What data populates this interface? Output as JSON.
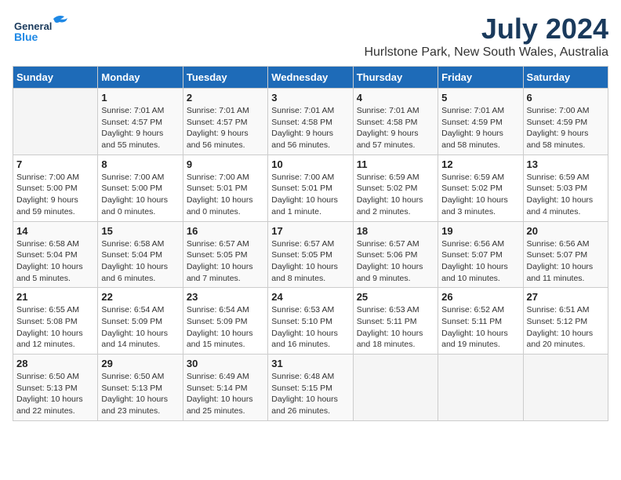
{
  "logo": {
    "text1": "General",
    "text2": "Blue"
  },
  "title": "July 2024",
  "subtitle": "Hurlstone Park, New South Wales, Australia",
  "days_of_week": [
    "Sunday",
    "Monday",
    "Tuesday",
    "Wednesday",
    "Thursday",
    "Friday",
    "Saturday"
  ],
  "weeks": [
    [
      {
        "day": "",
        "info": ""
      },
      {
        "day": "1",
        "info": "Sunrise: 7:01 AM\nSunset: 4:57 PM\nDaylight: 9 hours\nand 55 minutes."
      },
      {
        "day": "2",
        "info": "Sunrise: 7:01 AM\nSunset: 4:57 PM\nDaylight: 9 hours\nand 56 minutes."
      },
      {
        "day": "3",
        "info": "Sunrise: 7:01 AM\nSunset: 4:58 PM\nDaylight: 9 hours\nand 56 minutes."
      },
      {
        "day": "4",
        "info": "Sunrise: 7:01 AM\nSunset: 4:58 PM\nDaylight: 9 hours\nand 57 minutes."
      },
      {
        "day": "5",
        "info": "Sunrise: 7:01 AM\nSunset: 4:59 PM\nDaylight: 9 hours\nand 58 minutes."
      },
      {
        "day": "6",
        "info": "Sunrise: 7:00 AM\nSunset: 4:59 PM\nDaylight: 9 hours\nand 58 minutes."
      }
    ],
    [
      {
        "day": "7",
        "info": "Sunrise: 7:00 AM\nSunset: 5:00 PM\nDaylight: 9 hours\nand 59 minutes."
      },
      {
        "day": "8",
        "info": "Sunrise: 7:00 AM\nSunset: 5:00 PM\nDaylight: 10 hours\nand 0 minutes."
      },
      {
        "day": "9",
        "info": "Sunrise: 7:00 AM\nSunset: 5:01 PM\nDaylight: 10 hours\nand 0 minutes."
      },
      {
        "day": "10",
        "info": "Sunrise: 7:00 AM\nSunset: 5:01 PM\nDaylight: 10 hours\nand 1 minute."
      },
      {
        "day": "11",
        "info": "Sunrise: 6:59 AM\nSunset: 5:02 PM\nDaylight: 10 hours\nand 2 minutes."
      },
      {
        "day": "12",
        "info": "Sunrise: 6:59 AM\nSunset: 5:02 PM\nDaylight: 10 hours\nand 3 minutes."
      },
      {
        "day": "13",
        "info": "Sunrise: 6:59 AM\nSunset: 5:03 PM\nDaylight: 10 hours\nand 4 minutes."
      }
    ],
    [
      {
        "day": "14",
        "info": "Sunrise: 6:58 AM\nSunset: 5:04 PM\nDaylight: 10 hours\nand 5 minutes."
      },
      {
        "day": "15",
        "info": "Sunrise: 6:58 AM\nSunset: 5:04 PM\nDaylight: 10 hours\nand 6 minutes."
      },
      {
        "day": "16",
        "info": "Sunrise: 6:57 AM\nSunset: 5:05 PM\nDaylight: 10 hours\nand 7 minutes."
      },
      {
        "day": "17",
        "info": "Sunrise: 6:57 AM\nSunset: 5:05 PM\nDaylight: 10 hours\nand 8 minutes."
      },
      {
        "day": "18",
        "info": "Sunrise: 6:57 AM\nSunset: 5:06 PM\nDaylight: 10 hours\nand 9 minutes."
      },
      {
        "day": "19",
        "info": "Sunrise: 6:56 AM\nSunset: 5:07 PM\nDaylight: 10 hours\nand 10 minutes."
      },
      {
        "day": "20",
        "info": "Sunrise: 6:56 AM\nSunset: 5:07 PM\nDaylight: 10 hours\nand 11 minutes."
      }
    ],
    [
      {
        "day": "21",
        "info": "Sunrise: 6:55 AM\nSunset: 5:08 PM\nDaylight: 10 hours\nand 12 minutes."
      },
      {
        "day": "22",
        "info": "Sunrise: 6:54 AM\nSunset: 5:09 PM\nDaylight: 10 hours\nand 14 minutes."
      },
      {
        "day": "23",
        "info": "Sunrise: 6:54 AM\nSunset: 5:09 PM\nDaylight: 10 hours\nand 15 minutes."
      },
      {
        "day": "24",
        "info": "Sunrise: 6:53 AM\nSunset: 5:10 PM\nDaylight: 10 hours\nand 16 minutes."
      },
      {
        "day": "25",
        "info": "Sunrise: 6:53 AM\nSunset: 5:11 PM\nDaylight: 10 hours\nand 18 minutes."
      },
      {
        "day": "26",
        "info": "Sunrise: 6:52 AM\nSunset: 5:11 PM\nDaylight: 10 hours\nand 19 minutes."
      },
      {
        "day": "27",
        "info": "Sunrise: 6:51 AM\nSunset: 5:12 PM\nDaylight: 10 hours\nand 20 minutes."
      }
    ],
    [
      {
        "day": "28",
        "info": "Sunrise: 6:50 AM\nSunset: 5:13 PM\nDaylight: 10 hours\nand 22 minutes."
      },
      {
        "day": "29",
        "info": "Sunrise: 6:50 AM\nSunset: 5:13 PM\nDaylight: 10 hours\nand 23 minutes."
      },
      {
        "day": "30",
        "info": "Sunrise: 6:49 AM\nSunset: 5:14 PM\nDaylight: 10 hours\nand 25 minutes."
      },
      {
        "day": "31",
        "info": "Sunrise: 6:48 AM\nSunset: 5:15 PM\nDaylight: 10 hours\nand 26 minutes."
      },
      {
        "day": "",
        "info": ""
      },
      {
        "day": "",
        "info": ""
      },
      {
        "day": "",
        "info": ""
      }
    ]
  ]
}
